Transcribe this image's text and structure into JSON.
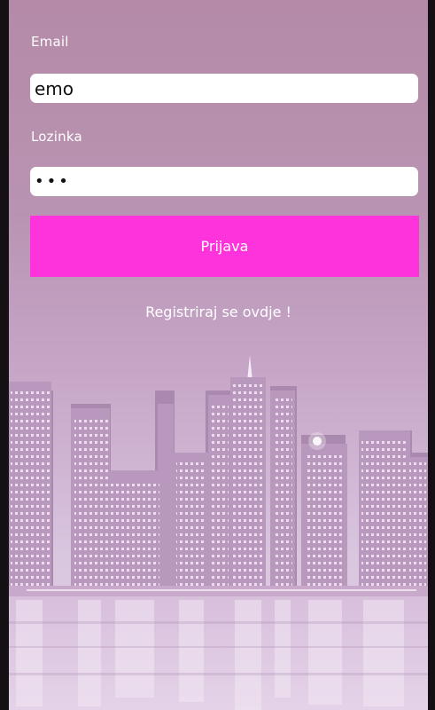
{
  "login_form": {
    "email_label": "Email",
    "email_value": "emo",
    "password_label": "Lozinka",
    "password_value": "•••",
    "login_button": "Prijava",
    "register_link": "Registriraj se ovdje !"
  },
  "colors": {
    "accent": "#ff33db",
    "overlay": "#b994b2"
  },
  "background": {
    "icon": "city-skyline-background"
  }
}
